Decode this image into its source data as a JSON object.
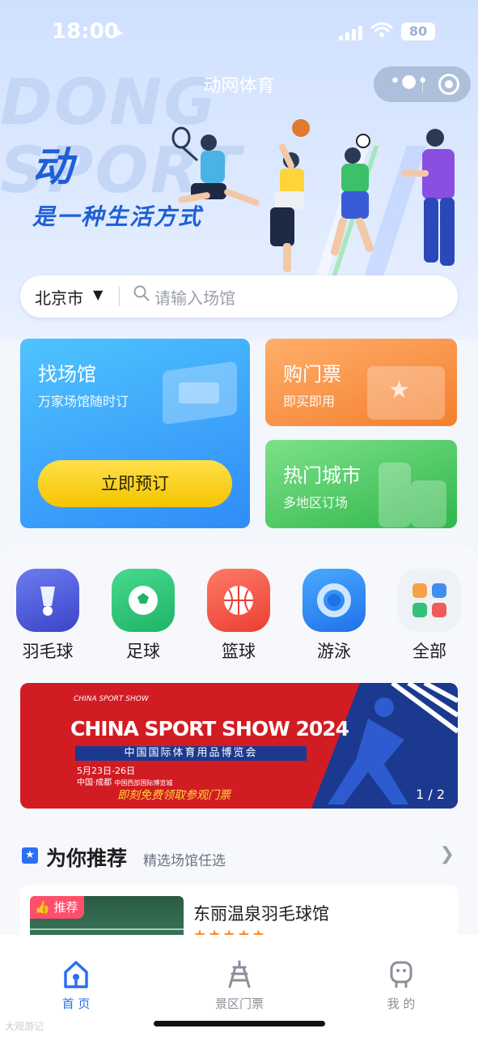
{
  "status": {
    "time": "18:00",
    "battery": "80"
  },
  "app": {
    "title": "动网体育"
  },
  "hero": {
    "bg_text_1": "DONG",
    "bg_text_2": "SPORT",
    "slogan_1": "动",
    "slogan_2": "是一种生活方式"
  },
  "search": {
    "city": "北京市",
    "placeholder": "请输入场馆"
  },
  "cards": {
    "main": {
      "title": "找场馆",
      "subtitle": "万家场馆随时订",
      "button": "立即预订"
    },
    "ticket": {
      "title": "购门票",
      "subtitle": "即买即用"
    },
    "hot": {
      "title": "热门城市",
      "subtitle": "多地区订场"
    }
  },
  "categories": [
    {
      "label": "羽毛球",
      "icon": "badminton-icon",
      "color": "#4a56d8"
    },
    {
      "label": "足球",
      "icon": "football-icon",
      "color": "#28c07a"
    },
    {
      "label": "篮球",
      "icon": "basketball-icon",
      "color": "#f25b4a"
    },
    {
      "label": "游泳",
      "icon": "swimming-icon",
      "color": "#2e8ef5"
    },
    {
      "label": "全部",
      "icon": "all-grid-icon",
      "color": "#f0f2f6"
    }
  ],
  "banner": {
    "brand": "CHINA SPORT SHOW",
    "title": "CHINA SPORT SHOW 2024",
    "subtitle": "中国国际体育用品博览会",
    "date": "5月23日-26日",
    "city": "中国·成都",
    "venue": "中国西部国际博览城",
    "cta": "即刻免费领取参观门票",
    "pager": "1 / 2"
  },
  "recommend": {
    "title": "为你推荐",
    "subtitle": "精选场馆任选",
    "items": [
      {
        "tag": "推荐",
        "name": "东丽温泉羽毛球馆",
        "stars": "★★★★★"
      }
    ]
  },
  "tabbar": [
    {
      "label": "首 页",
      "active": true
    },
    {
      "label": "景区门票",
      "active": false
    },
    {
      "label": "我 的",
      "active": false
    }
  ],
  "watermark": "大观游记",
  "colors": {
    "accent": "#2b6ff2",
    "hero_bg": "#d4e3ff",
    "banner_red": "#d21c24"
  }
}
